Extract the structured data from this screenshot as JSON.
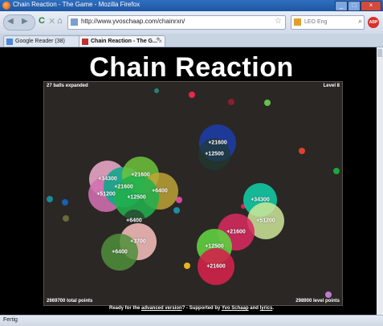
{
  "window": {
    "title": "Chain Reaction - The Game - Mozilla Firefox",
    "min_glyph": "_",
    "max_glyph": "□",
    "close_glyph": "×"
  },
  "navbar": {
    "url": "http://www.yvoschaap.com/chainrxn/",
    "search_placeholder": "LEO Eng",
    "back_glyph": "◀",
    "forward_glyph": "▶",
    "reload_glyph": "C",
    "stop_glyph": "✕",
    "home_glyph": "⌂",
    "star_glyph": "☆",
    "search_glyph": "⌕",
    "abp_label": "ABP"
  },
  "tabs": [
    {
      "label": "Google Reader (38)"
    },
    {
      "label": "Chain Reaction - The G..."
    }
  ],
  "tab_close_glyph": "×",
  "new_tab_glyph": "+",
  "game": {
    "heading": "Chain Reaction",
    "balls_expanded": "27 balls expanded",
    "level": "Level 8",
    "total_points": "2669700 total points",
    "level_points": "298900 level points",
    "footer_pre": "Ready for the ",
    "footer_link1": "advanced version",
    "footer_mid": "? - Supported by ",
    "footer_link2": "Yvo Schaap",
    "footer_and": " and ",
    "footer_link3": "lyrics",
    "footer_end": "."
  },
  "balls": [
    {
      "color": "#e9a8c8",
      "label": "+34300"
    },
    {
      "color": "#d36fb1",
      "label": "+51200"
    },
    {
      "color": "#10a98a",
      "label": "+21600"
    },
    {
      "color": "#6ec43c",
      "label": "+21600"
    },
    {
      "color": "#c3a637",
      "label": "+6400"
    },
    {
      "color": "#22b14c",
      "label": "+12500"
    },
    {
      "color": "#1d3b9e",
      "label": "+21600"
    },
    {
      "color": "#1f3b2e",
      "label": "+12500"
    },
    {
      "color": "#12c4a0",
      "label": "+34300"
    },
    {
      "color": "#cfe89a",
      "label": "+51200"
    },
    {
      "color": "#d62a5e",
      "label": "+21600"
    },
    {
      "color": "#2a2a2a",
      "label": "+6400"
    },
    {
      "color": "#f0b8b8",
      "label": "+3700"
    },
    {
      "color": "#4f8f3b",
      "label": "+6400"
    },
    {
      "color": "#5fd040",
      "label": "+12500"
    },
    {
      "color": "#d2234a",
      "label": "+21600"
    }
  ],
  "dots": [
    {
      "color": "#e6274a"
    },
    {
      "color": "#2b7f7a"
    },
    {
      "color": "#8a1f2c"
    },
    {
      "color": "#65c048"
    },
    {
      "color": "#e04030"
    },
    {
      "color": "#1aa83a"
    },
    {
      "color": "#1a8a99"
    },
    {
      "color": "#1a5fb0"
    },
    {
      "color": "#6a6a3a"
    },
    {
      "color": "#d54aa0"
    },
    {
      "color": "#e9b31d"
    },
    {
      "color": "#c07ad0"
    },
    {
      "color": "#1a8fa5"
    },
    {
      "color": "#e01f4f"
    }
  ],
  "status": "Fertig"
}
